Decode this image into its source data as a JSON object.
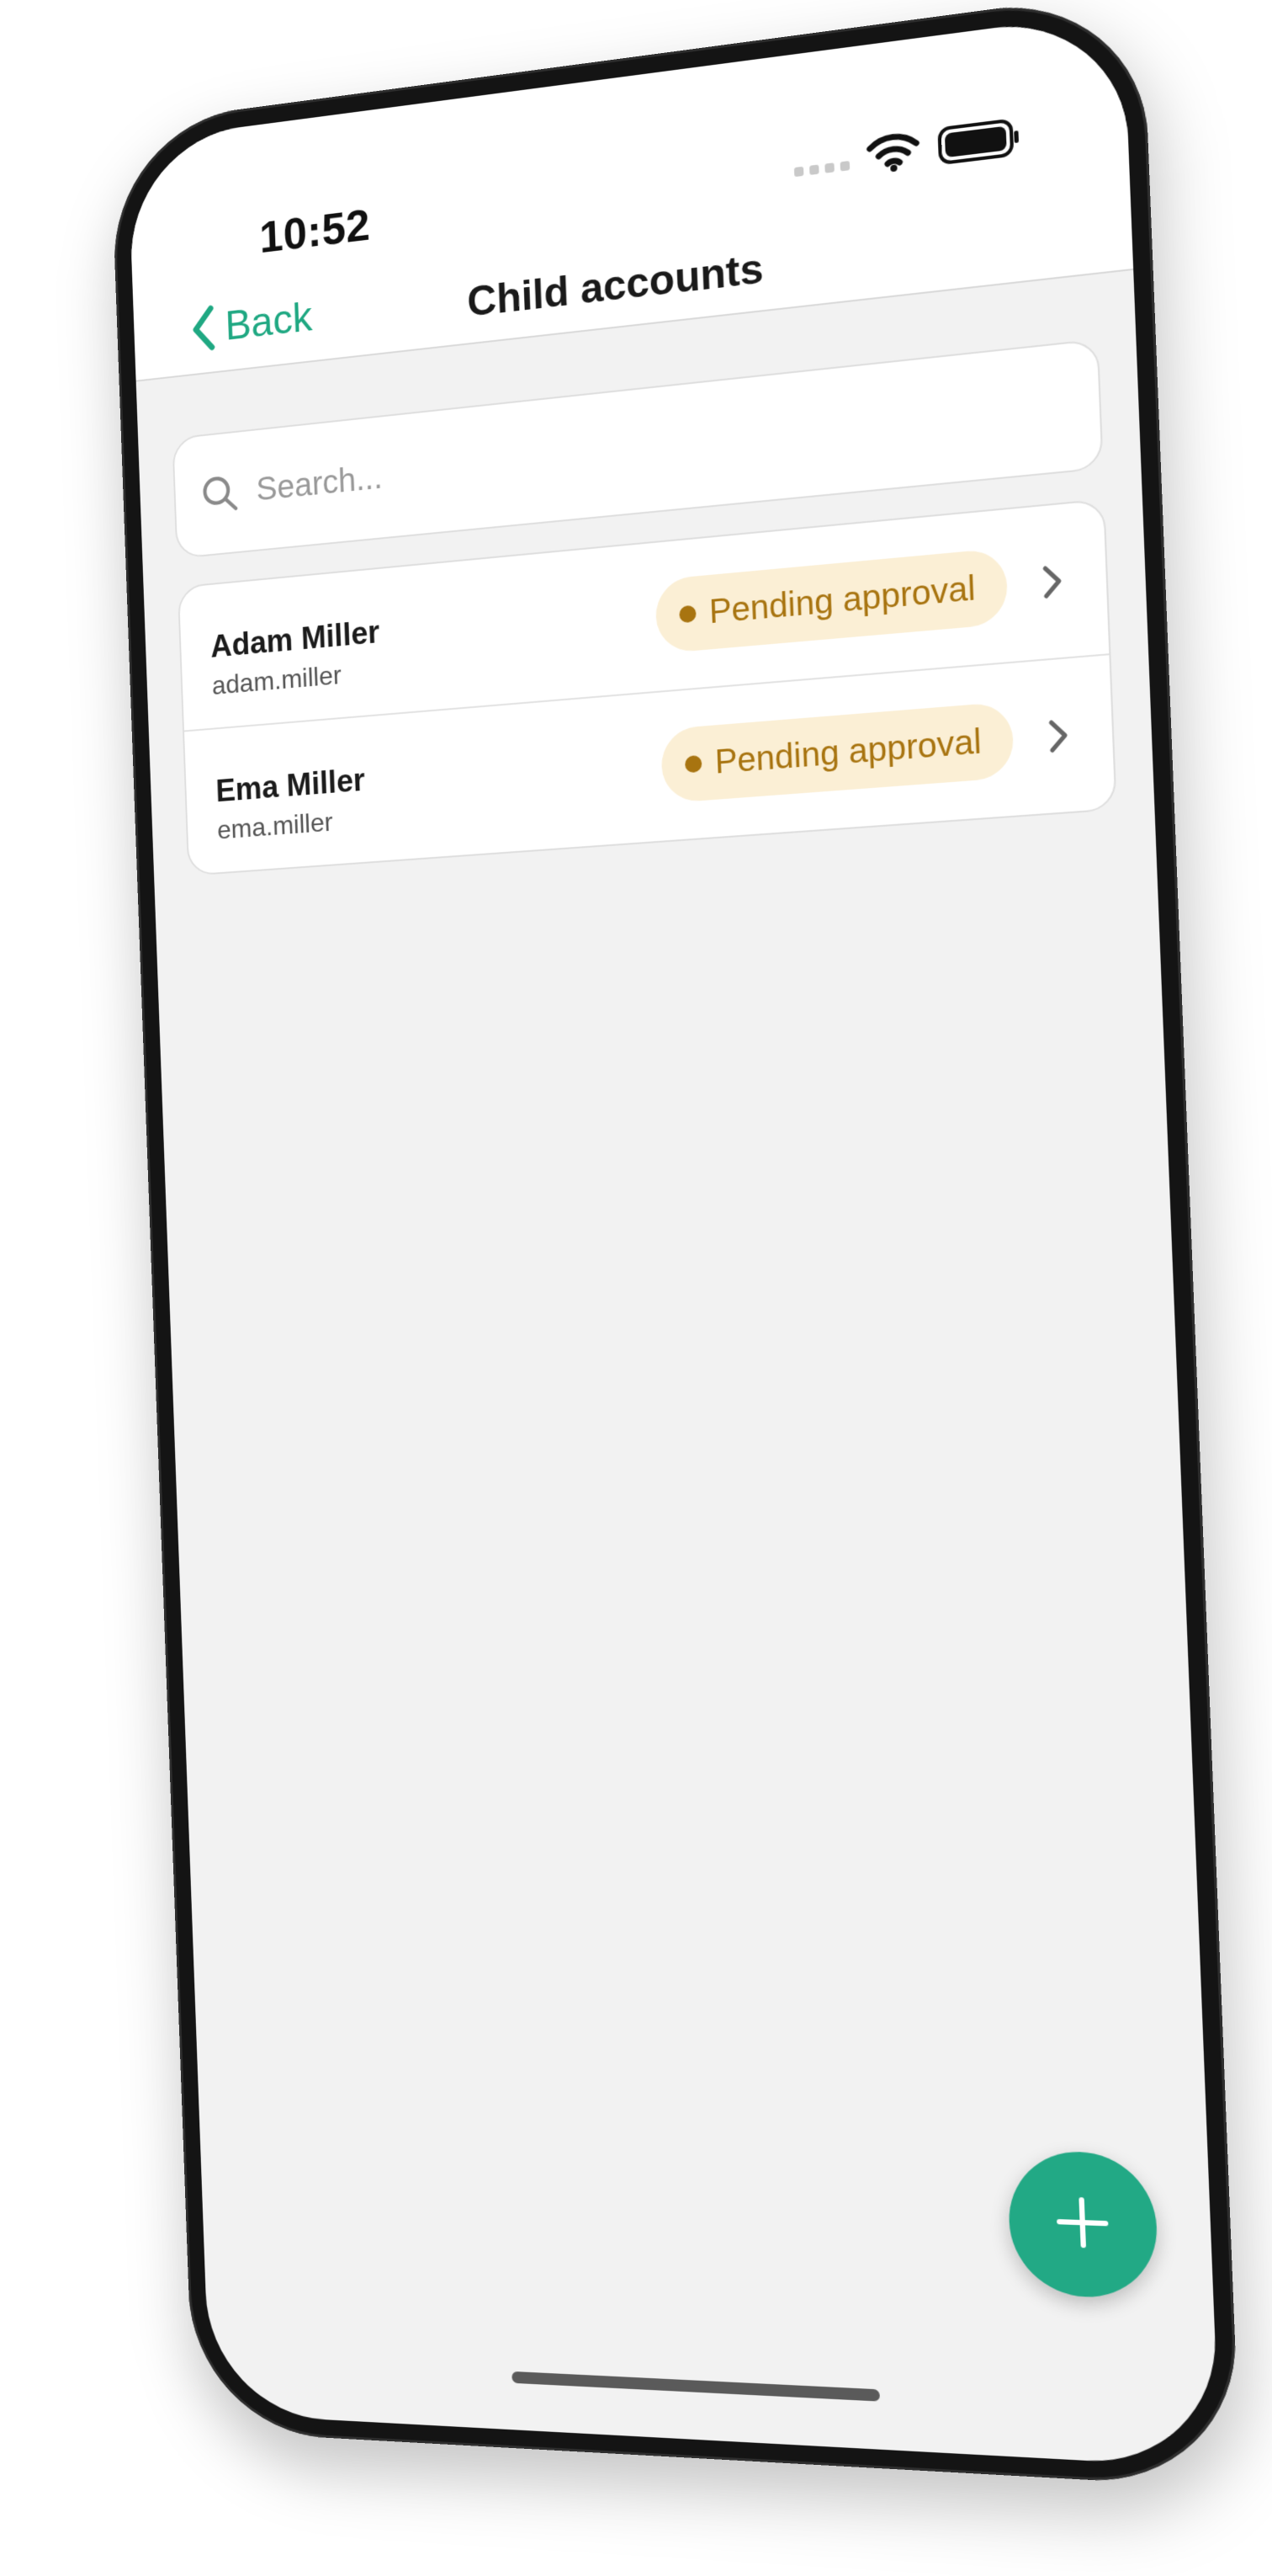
{
  "status_bar": {
    "time": "10:52"
  },
  "nav": {
    "back_label": "Back",
    "title": "Child accounts"
  },
  "search": {
    "placeholder": "Search..."
  },
  "accounts": [
    {
      "name": "Adam Miller",
      "username": "adam.miller",
      "status": "Pending approval"
    },
    {
      "name": "Ema Miller",
      "username": "ema.miller",
      "status": "Pending approval"
    }
  ],
  "colors": {
    "accent": "#22a985",
    "badge_bg": "#fbefd5",
    "badge_text": "#a87410",
    "screen_bg": "#f2f2f2"
  },
  "icons": {
    "back": "chevron-left-icon",
    "search": "search-icon",
    "row_chevron": "chevron-right-icon",
    "fab": "plus-icon",
    "wifi": "wifi-icon",
    "battery": "battery-icon"
  }
}
